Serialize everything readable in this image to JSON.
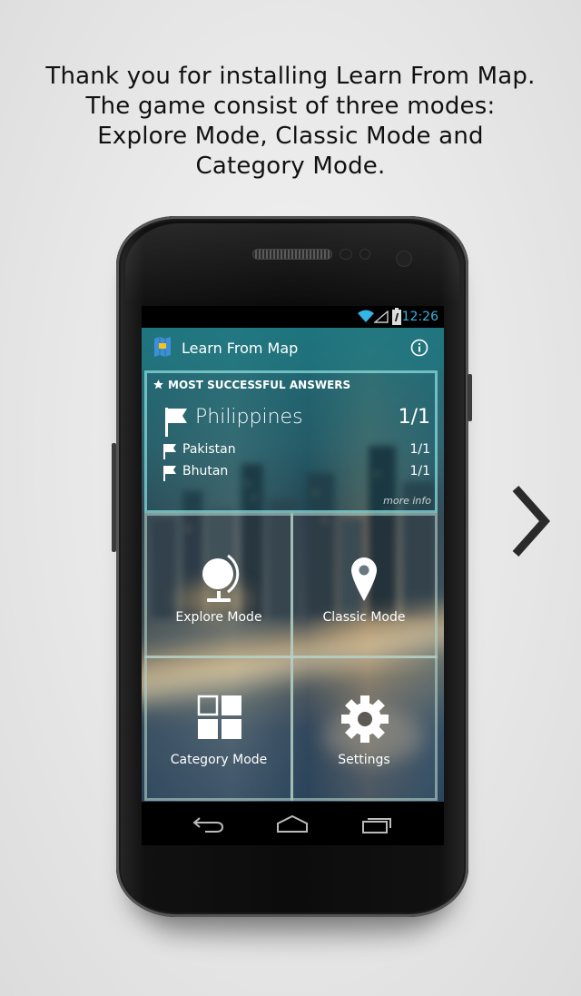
{
  "intro": {
    "lines": [
      "Thank you for installing Learn From Map.",
      "The game consist of three modes:",
      "Explore Mode, Classic Mode and",
      "Category Mode."
    ]
  },
  "statusbar": {
    "time": "12:26",
    "accent": "#33b5e5"
  },
  "actionbar": {
    "title": "Learn From Map",
    "icon": "map-flag-icon",
    "action_icon": "info-icon"
  },
  "stats": {
    "heading": "MOST SUCCESSFUL ANSWERS",
    "top": {
      "name": "Philippines",
      "score": "1/1"
    },
    "rows": [
      {
        "name": "Pakistan",
        "score": "1/1"
      },
      {
        "name": "Bhutan",
        "score": "1/1"
      }
    ],
    "more": "more info"
  },
  "tiles": [
    {
      "label": "Explore Mode",
      "icon": "globe-icon"
    },
    {
      "label": "Classic Mode",
      "icon": "map-pin-icon"
    },
    {
      "label": "Category Mode",
      "icon": "grid-icon"
    },
    {
      "label": "Settings",
      "icon": "gear-icon"
    }
  ],
  "navbar": {
    "icons": [
      "back-icon",
      "home-icon",
      "recent-apps-icon"
    ]
  },
  "pager": {
    "icon": "chevron-right-icon"
  }
}
